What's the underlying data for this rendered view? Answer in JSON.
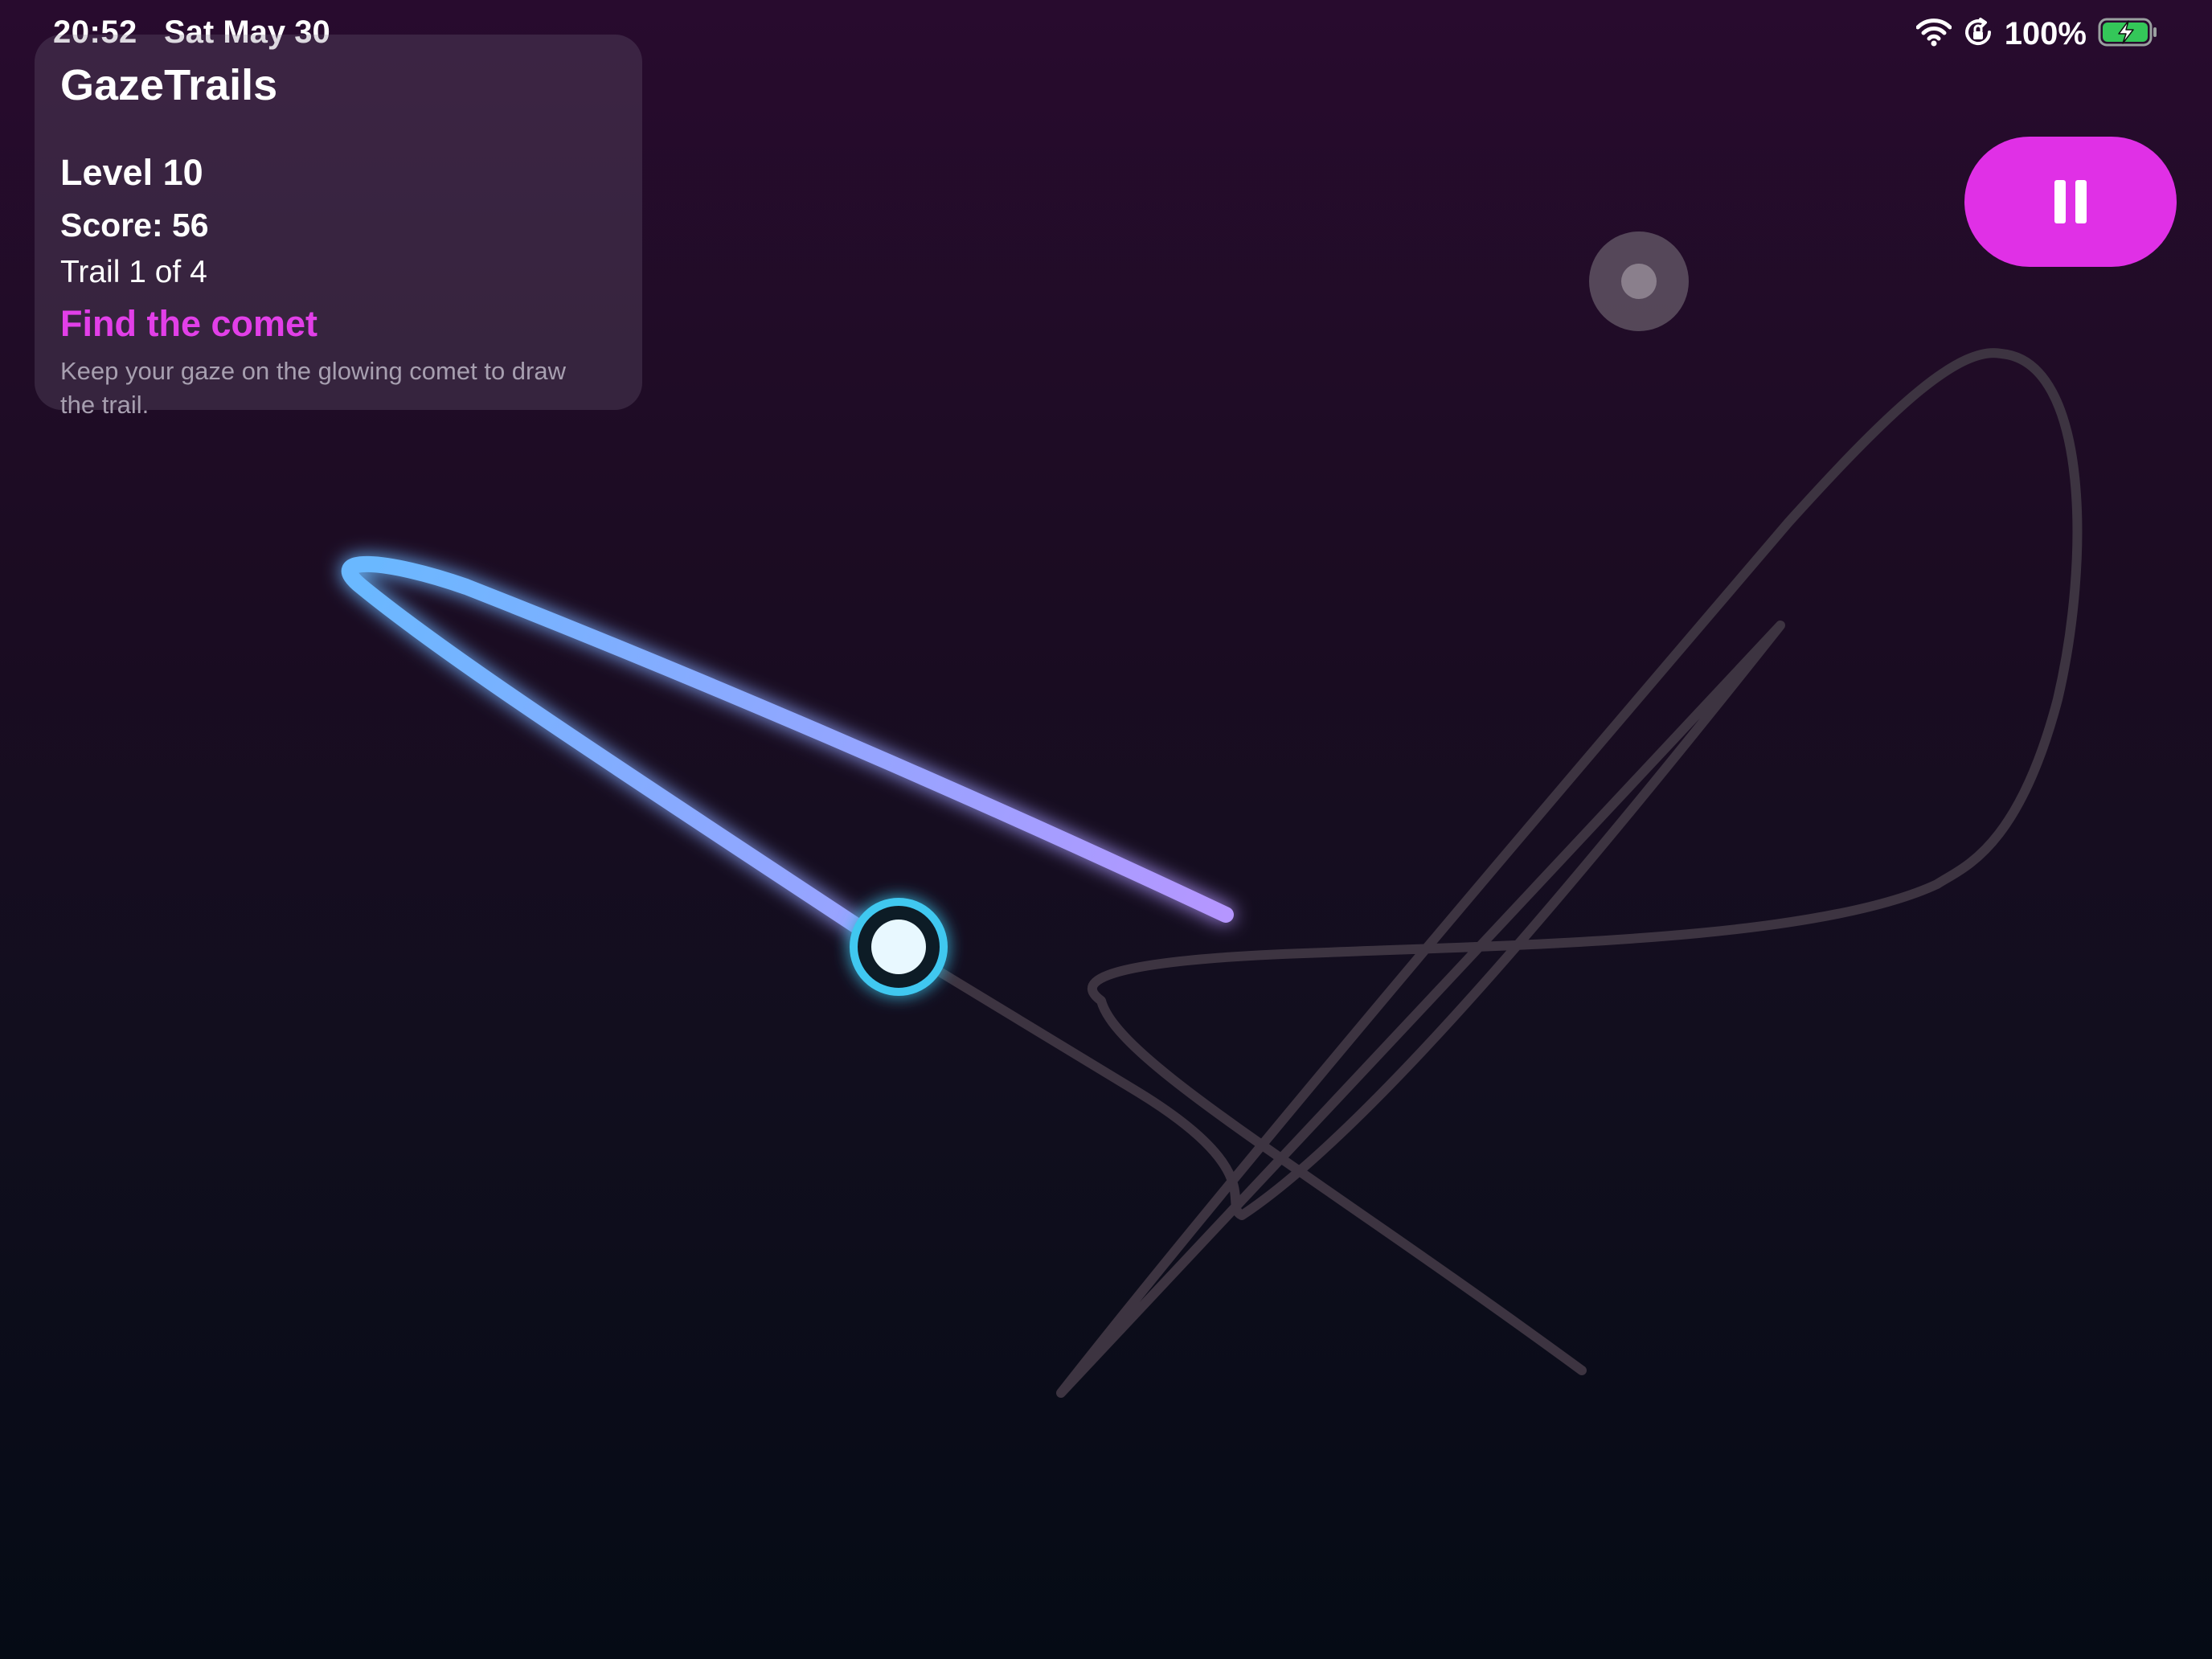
{
  "status_bar": {
    "time": "20:52",
    "date": "Sat May 30",
    "battery_percent": "100%",
    "battery_level": 1.0,
    "charging": true,
    "icons": [
      "wifi-icon",
      "orientation-lock-icon",
      "battery-charging-icon"
    ]
  },
  "hud": {
    "title": "GazeTrails",
    "level": "Level 10",
    "score": "Score: 56",
    "trail_progress": "Trail 1 of 4",
    "objective": "Find the comet",
    "hint": "Keep your gaze on the glowing comet to draw the trail."
  },
  "controls": {
    "pause_icon": "pause-icon"
  },
  "colors": {
    "accent": "#e030e6",
    "objective_text": "#e23fe8",
    "trail_start": "#6ab8ff",
    "trail_end": "#b596ff",
    "comet_ring": "#3fc8f0",
    "guide_path": "#3d3441"
  },
  "game": {
    "comet_icon": "comet-icon",
    "gaze_cursor_icon": "gaze-cursor-icon"
  }
}
